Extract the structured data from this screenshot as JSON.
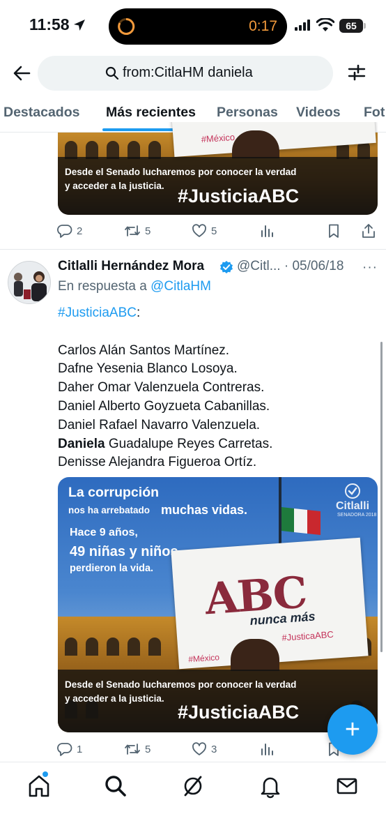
{
  "status_bar": {
    "time": "11:58",
    "timer": "0:17",
    "battery": "65"
  },
  "search": {
    "query": "from:CitlaHM daniela"
  },
  "tabs": [
    {
      "label": "Destacados",
      "active": false
    },
    {
      "label": "Más recientes",
      "active": true
    },
    {
      "label": "Personas",
      "active": false
    },
    {
      "label": "Videos",
      "active": false
    },
    {
      "label": "Fot",
      "active": false
    }
  ],
  "tweet1": {
    "media": {
      "caption": "Desde el Senado lucharemos por conocer la verdad\ny acceder a la justicia.",
      "hashtag": "#JusticiaABC",
      "sign_text": "#México"
    },
    "stats": {
      "replies": "2",
      "retweets": "5",
      "likes": "5"
    }
  },
  "tweet2": {
    "name": "Citlalli Hernández Mora",
    "handle": "@Citl...",
    "date": "05/06/18",
    "reply_prefix": "En respuesta a",
    "reply_to": "@CitlaHM",
    "hashtag": "#JusticiaABC",
    "colon": ":",
    "lines": [
      "Carlos Alán Santos Martínez.",
      "Dafne Yesenia Blanco Losoya.",
      "Daher Omar Valenzuela Contreras.",
      "Daniel Alberto Goyzueta Cabanillas.",
      "Daniel Rafael Navarro Valenzuela."
    ],
    "bold_name": "Daniela",
    "bold_line_rest": " Guadalupe Reyes Carretas.",
    "last_line": "Denisse Alejandra Figueroa Ortíz.",
    "media": {
      "line1": "La corrupción",
      "line2a": "nos ha arrebatado",
      "line2b": "muchas vidas.",
      "line3": "Hace 9 años,",
      "line4": "49 niñas y niños",
      "line5": "perdieron la vida.",
      "logo": "Citlalli",
      "logo_sub": "SENADORA 2018",
      "sign_main": "ABC",
      "sign_sub": "nunca más",
      "sign_tag": "#JusticaABC",
      "sign_mexico": "#México",
      "caption": "Desde el Senado lucharemos por conocer la verdad\ny acceder a la justicia.",
      "hashtag": "#JusticiaABC"
    },
    "stats": {
      "replies": "1",
      "retweets": "5",
      "likes": "3"
    }
  },
  "fab_label": "+",
  "colors": {
    "accent": "#1d9bf0",
    "text": "#0f1419",
    "muted": "#536471"
  }
}
